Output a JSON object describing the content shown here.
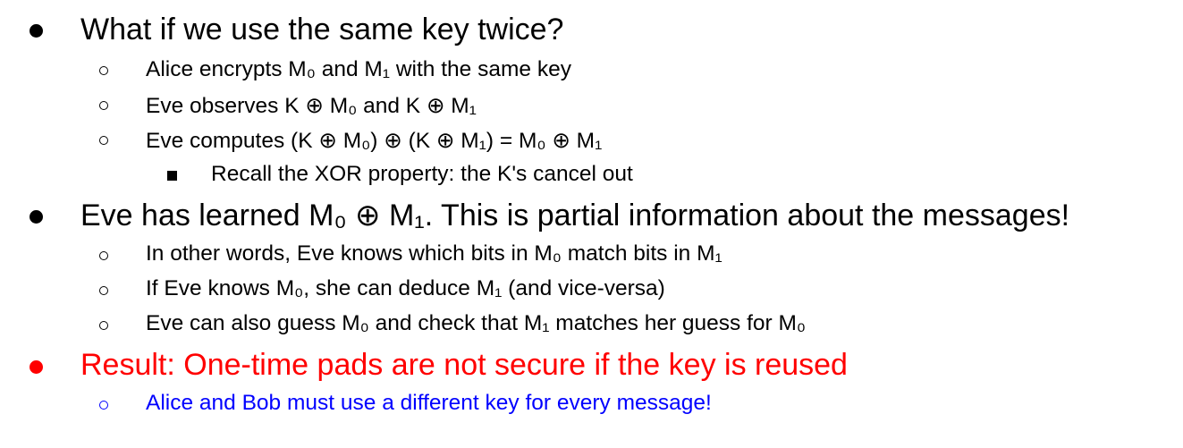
{
  "slide": {
    "bullets": [
      {
        "level": 1,
        "text": "What if we use the same key twice?"
      },
      {
        "level": 2,
        "text": "Alice encrypts M₀ and M₁ with the same key"
      },
      {
        "level": 2,
        "text": "Eve observes K ⊕ M₀ and K ⊕ M₁"
      },
      {
        "level": 2,
        "text": "Eve computes (K ⊕ M₀) ⊕ (K ⊕ M₁) = M₀ ⊕ M₁"
      },
      {
        "level": 3,
        "text": "Recall the XOR property: the K's cancel out"
      },
      {
        "level": 1,
        "text": "Eve has learned M₀ ⊕ M₁. This is partial information about the messages!"
      },
      {
        "level": 2,
        "text": "In other words, Eve knows which bits in M₀ match bits in M₁"
      },
      {
        "level": 2,
        "text": "If Eve knows M₀, she can deduce M₁ (and vice-versa)"
      },
      {
        "level": 2,
        "text": "Eve can also guess M₀ and check that M₁ matches her guess for M₀"
      },
      {
        "level": 1,
        "text": "Result: One-time pads are not secure if the key is reused",
        "color": "#ff0000"
      },
      {
        "level": 2,
        "text": "Alice and Bob must use a different key for every message!",
        "color": "#0000ff"
      }
    ]
  },
  "colors": {
    "text": "#000000",
    "emphasis_red": "#ff0000",
    "emphasis_blue": "#0000ff",
    "background": "#ffffff"
  },
  "icons": {
    "level1": "filled-circle-bullet-icon",
    "level2": "hollow-circle-bullet-icon",
    "level3": "filled-square-bullet-icon"
  }
}
